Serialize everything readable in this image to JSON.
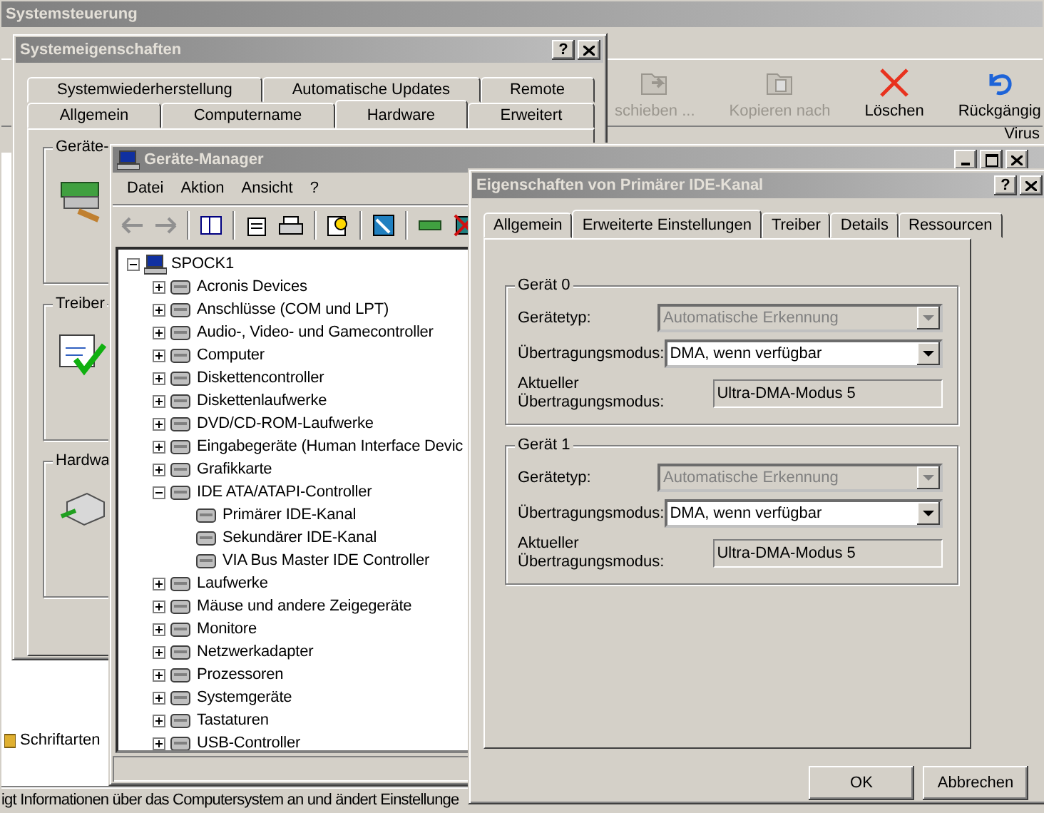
{
  "control_panel": {
    "title": "Systemsteuerung",
    "toolbar": [
      {
        "kind": "move",
        "label": "schieben ...",
        "disabled": true
      },
      {
        "kind": "copy",
        "label": "Kopieren nach",
        "disabled": true
      },
      {
        "kind": "delete",
        "label": "Löschen",
        "disabled": false
      },
      {
        "kind": "undo",
        "label": "Rückgängig",
        "disabled": false
      }
    ],
    "column_fragment": "Virus",
    "items": [
      {
        "label": "Schriftarten"
      }
    ],
    "status_bar": "igt Informationen über das Computersystem an und ändert Einstellunge"
  },
  "system_properties": {
    "title": "Systemeigenschaften",
    "help_button": "?",
    "tab_rows": [
      [
        {
          "label": "Systemwiederherstellung",
          "selected": false
        },
        {
          "label": "Automatische Updates",
          "selected": false
        },
        {
          "label": "Remote",
          "selected": false
        }
      ],
      [
        {
          "label": "Allgemein",
          "selected": false
        },
        {
          "label": "Computername",
          "selected": false
        },
        {
          "label": "Hardware",
          "selected": true
        },
        {
          "label": "Erweitert",
          "selected": false
        }
      ]
    ],
    "groups": [
      {
        "kind": "devices",
        "title": "Geräte-"
      },
      {
        "kind": "drivers",
        "title": "Treiber"
      },
      {
        "kind": "hardware",
        "title": "Hardwa"
      }
    ]
  },
  "device_manager": {
    "title": "Geräte-Manager",
    "menu": [
      "Datei",
      "Aktion",
      "Ansicht",
      "?"
    ],
    "tree": {
      "label": "SPOCK1",
      "expanded": true,
      "children": [
        {
          "label": "Acronis Devices",
          "expanded": false
        },
        {
          "label": "Anschlüsse (COM und LPT)",
          "expanded": false
        },
        {
          "label": "Audio-, Video- und Gamecontroller",
          "expanded": false
        },
        {
          "label": "Computer",
          "expanded": false
        },
        {
          "label": "Diskettencontroller",
          "expanded": false
        },
        {
          "label": "Diskettenlaufwerke",
          "expanded": false
        },
        {
          "label": "DVD/CD-ROM-Laufwerke",
          "expanded": false
        },
        {
          "label": "Eingabegeräte (Human Interface Devic",
          "expanded": false
        },
        {
          "label": "Grafikkarte",
          "expanded": false
        },
        {
          "label": "IDE ATA/ATAPI-Controller",
          "expanded": true,
          "children": [
            {
              "label": "Primärer IDE-Kanal"
            },
            {
              "label": "Sekundärer IDE-Kanal"
            },
            {
              "label": "VIA Bus Master IDE Controller"
            }
          ]
        },
        {
          "label": "Laufwerke",
          "expanded": false
        },
        {
          "label": "Mäuse und andere Zeigegeräte",
          "expanded": false
        },
        {
          "label": "Monitore",
          "expanded": false
        },
        {
          "label": "Netzwerkadapter",
          "expanded": false
        },
        {
          "label": "Prozessoren",
          "expanded": false
        },
        {
          "label": "Systemgeräte",
          "expanded": false
        },
        {
          "label": "Tastaturen",
          "expanded": false
        },
        {
          "label": "USB-Controller",
          "expanded": false
        }
      ]
    }
  },
  "properties_dialog": {
    "title": "Eigenschaften von Primärer IDE-Kanal",
    "help_button": "?",
    "tabs": [
      {
        "label": "Allgemein",
        "selected": false
      },
      {
        "label": "Erweiterte Einstellungen",
        "selected": true
      },
      {
        "label": "Treiber",
        "selected": false
      },
      {
        "label": "Details",
        "selected": false
      },
      {
        "label": "Ressourcen",
        "selected": false
      }
    ],
    "devices": [
      {
        "title": "Gerät 0",
        "fields": [
          {
            "kind": "dropdown",
            "label": "Gerätetyp:",
            "value": "Automatische Erkennung",
            "disabled": true
          },
          {
            "kind": "dropdown",
            "label": "Übertragungsmodus:",
            "value": "DMA, wenn verfügbar",
            "disabled": false
          },
          {
            "kind": "readonly",
            "label": "Aktueller Übertragungsmodus:",
            "value": "Ultra-DMA-Modus 5"
          }
        ]
      },
      {
        "title": "Gerät 1",
        "fields": [
          {
            "kind": "dropdown",
            "label": "Gerätetyp:",
            "value": "Automatische Erkennung",
            "disabled": true
          },
          {
            "kind": "dropdown",
            "label": "Übertragungsmodus:",
            "value": "DMA, wenn verfügbar",
            "disabled": false
          },
          {
            "kind": "readonly",
            "label": "Aktueller Übertragungsmodus:",
            "value": "Ultra-DMA-Modus 5"
          }
        ]
      }
    ],
    "buttons": [
      "OK",
      "Abbrechen"
    ]
  }
}
